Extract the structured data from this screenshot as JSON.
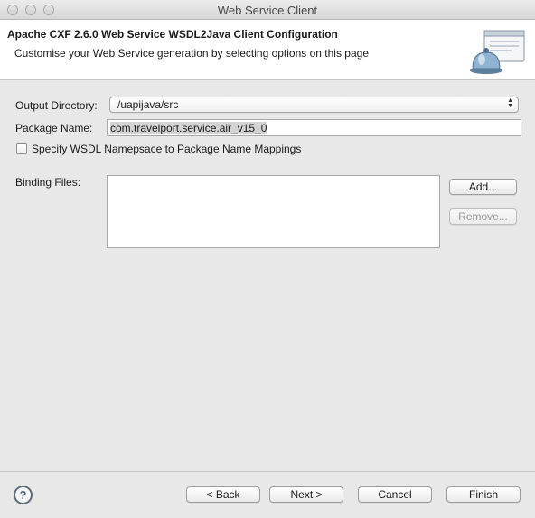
{
  "window": {
    "title": "Web Service Client"
  },
  "banner": {
    "title": "Apache CXF 2.6.0 Web Service WSDL2Java Client Configuration",
    "description": "Customise your Web Service generation by selecting options on this page",
    "icon": "web-service-bell-icon"
  },
  "form": {
    "output_directory": {
      "label": "Output Directory:",
      "value": "/uapijava/src"
    },
    "package_name": {
      "label": "Package Name:",
      "value": "com.travelport.service.air_v15_0"
    },
    "namespace_mapping": {
      "label": "Specify WSDL Namepsace to Package Name Mappings",
      "checked": false
    },
    "binding_files": {
      "label": "Binding Files:",
      "items": []
    }
  },
  "buttons": {
    "add": "Add...",
    "remove": "Remove...",
    "back": "< Back",
    "next": "Next >",
    "cancel": "Cancel",
    "finish": "Finish"
  },
  "help": {
    "symbol": "?"
  }
}
